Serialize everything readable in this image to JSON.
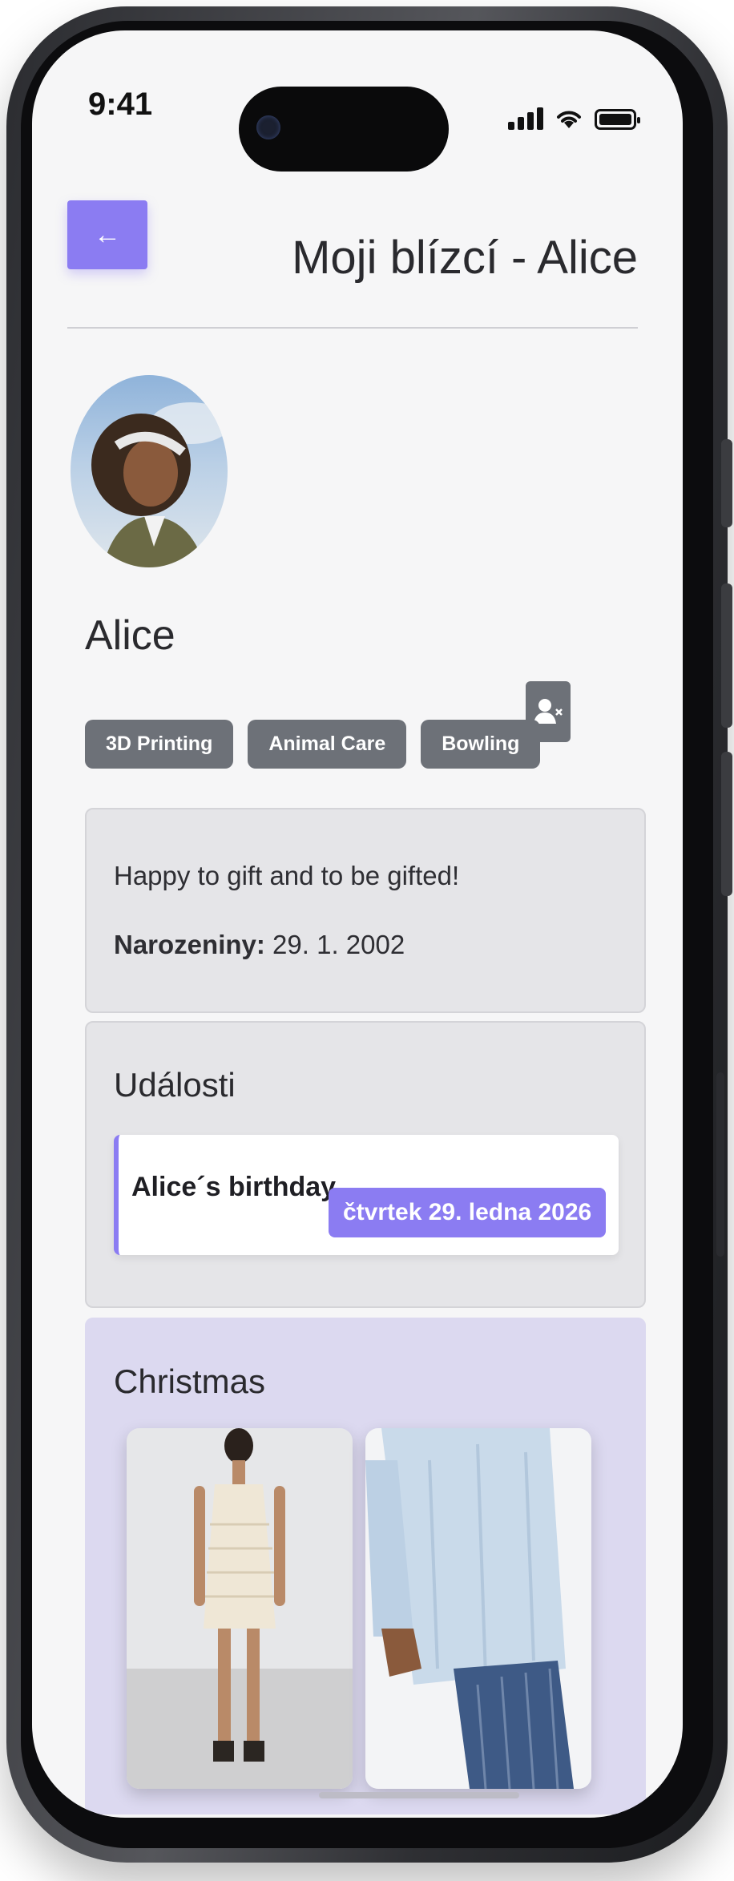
{
  "status_bar": {
    "time": "9:41",
    "icons": [
      "signal-icon",
      "wifi-icon",
      "battery-icon"
    ]
  },
  "header": {
    "back_icon": "arrow-left-icon",
    "back_label": "←",
    "title": "Moji blízcí - Alice"
  },
  "profile": {
    "name": "Alice",
    "remove_icon": "user-remove-icon",
    "interests": [
      "3D Printing",
      "Animal Care",
      "Bowling"
    ]
  },
  "about": {
    "bio": "Happy to gift and to be gifted!",
    "birthday_label": "Narozeniny:",
    "birthday_value": "29. 1. 2002"
  },
  "events": {
    "heading": "Události",
    "items": [
      {
        "name": "Alice´s birthday",
        "date": "čtvrtek 29. ledna 2026"
      }
    ]
  },
  "wishlist": {
    "heading": "Christmas",
    "items": [
      "knit-dress-photo",
      "linen-shirt-photo"
    ]
  },
  "colors": {
    "accent": "#8b7cf2",
    "tag_bg": "#6d7178",
    "card_bg": "#e5e5e8",
    "list_bg": "#dcd9f0"
  }
}
